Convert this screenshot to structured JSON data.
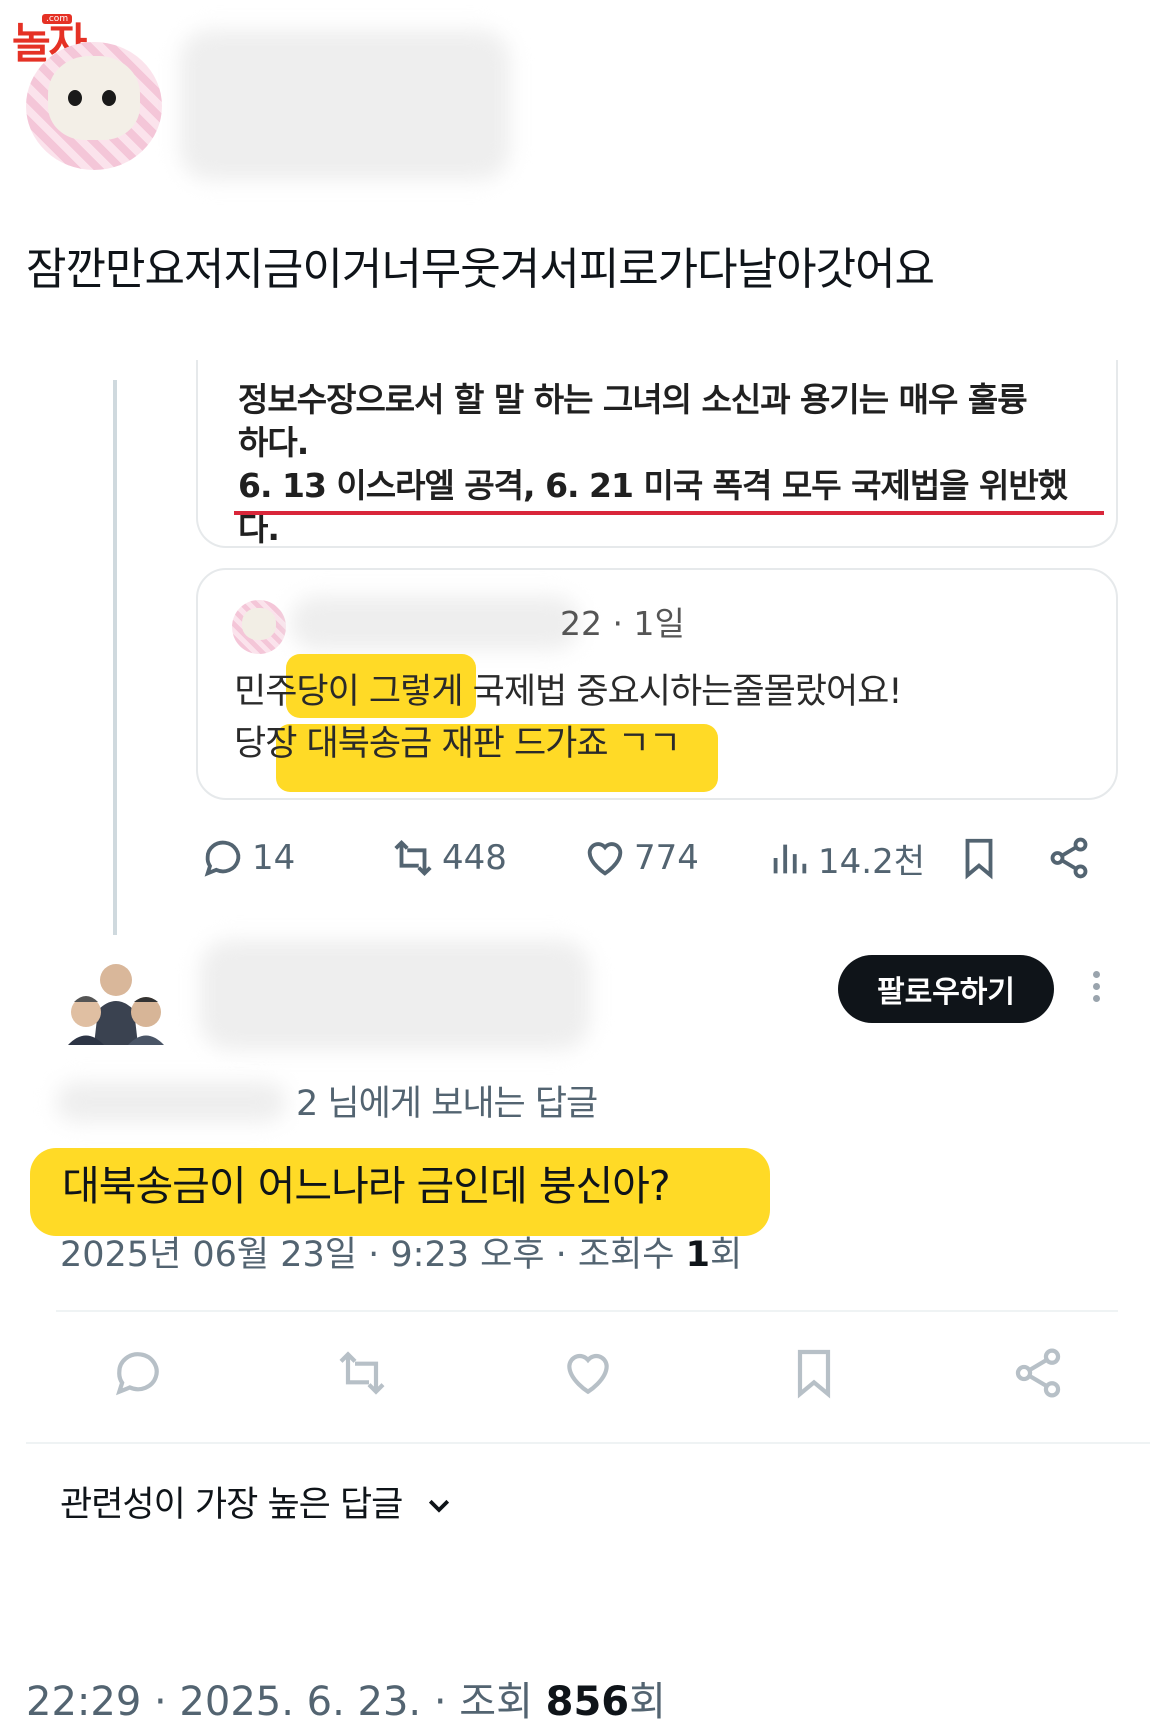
{
  "watermark": {
    "logo_text": "놀자",
    "logo_sub": ".com"
  },
  "post": {
    "text": "잠깐만요저지금이거너무웃겨서피로가다날아갓어요",
    "footer_time": "22:29 · 2025. 6. 23. · 조회 ",
    "footer_views": "856",
    "footer_unit": "회"
  },
  "quoted_article": {
    "line1": "정보수장으로서 할 말 하는 그녀의 소신과 용기는 매우 훌륭",
    "line2": "하다.",
    "line3": "6. 13 이스라엘 공격, 6. 21 미국 폭격 모두 국제법을 위반했",
    "line4": "다."
  },
  "inner_reply": {
    "time": "22 · 1일",
    "line1": "민주당이 그렇게 국제법 중요시하는줄몰랐어요!",
    "line2": "당장 대북송금 재판 드가죠 ㄱㄱ"
  },
  "actions": {
    "replies": "14",
    "reposts": "448",
    "likes": "774",
    "views": "14.2천"
  },
  "reply": {
    "follow_label": "팔로우하기",
    "reply_to": "2 님에게 보내는 답글",
    "body": "대북송금이 어느나라 금인데 붕신아?",
    "meta_prefix": "2025년 06월 23일 · 9:23 오후 · 조회수 ",
    "meta_views": "1",
    "meta_unit": "회"
  },
  "sort": {
    "label": "관련성이 가장 높은 답글"
  },
  "colors": {
    "highlight": "#ffd400",
    "underline": "#d9263a",
    "follow_bg": "#0f1419",
    "logo": "#e53125"
  }
}
